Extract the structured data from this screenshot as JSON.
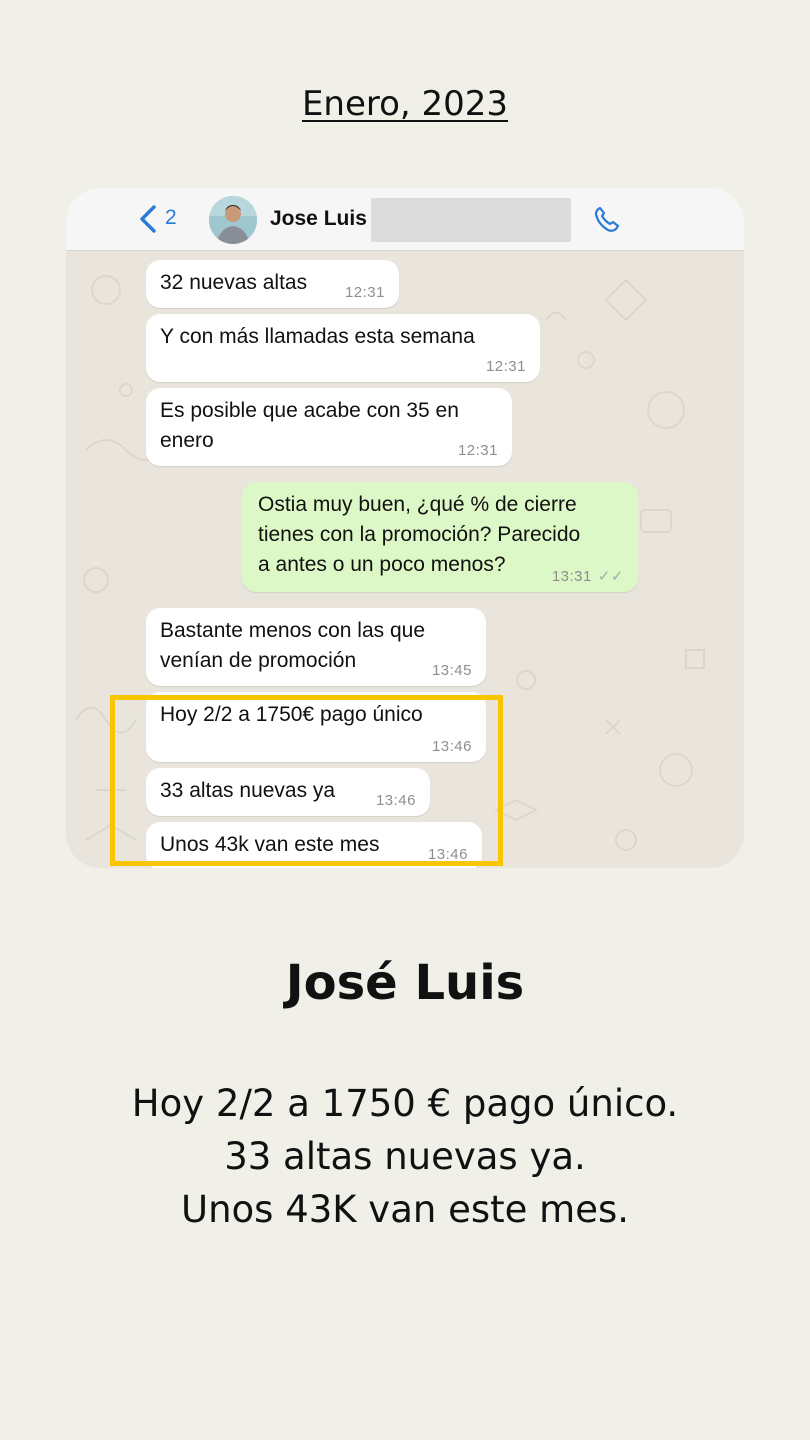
{
  "heading": {
    "date": "Enero, 2023"
  },
  "chat": {
    "back_count": "2",
    "contact_name": "Jose Luis .",
    "messages": [
      {
        "text": "32 nuevas altas",
        "time": "12:31",
        "direction": "in"
      },
      {
        "text": "Y con más llamadas esta semana",
        "time": "12:31",
        "direction": "in"
      },
      {
        "text": "Es posible que acabe con 35 en\nenero",
        "time": "12:31",
        "direction": "in"
      },
      {
        "text": "Ostia muy buen, ¿qué % de cierre\ntienes con la promoción? Parecido\na antes o un poco menos?",
        "time": "13:31",
        "direction": "out"
      },
      {
        "text": "Bastante menos con las que\nvenían de promoción",
        "time": "13:45",
        "direction": "in"
      },
      {
        "text": "Hoy 2/2 a 1750€ pago único",
        "time": "13:46",
        "direction": "in"
      },
      {
        "text": "33 altas nuevas ya",
        "time": "13:46",
        "direction": "in"
      },
      {
        "text": "Unos 43k van este mes",
        "time": "13:46",
        "direction": "in"
      }
    ]
  },
  "colors": {
    "page_background": "#f0efe8",
    "highlight": "#f7c600",
    "incoming_bubble": "#ffffff",
    "outgoing_bubble": "#dcf8c6",
    "ios_blue": "#2a7bd6"
  },
  "icons": {
    "back": "chevron-left-icon",
    "call": "phone-icon",
    "read": "double-check-icon"
  },
  "testimonial": {
    "name": "José Luis",
    "lines": [
      "Hoy 2/2 a 1750 € pago único.",
      "33 altas nuevas ya.",
      "Unos 43K van este mes."
    ]
  }
}
